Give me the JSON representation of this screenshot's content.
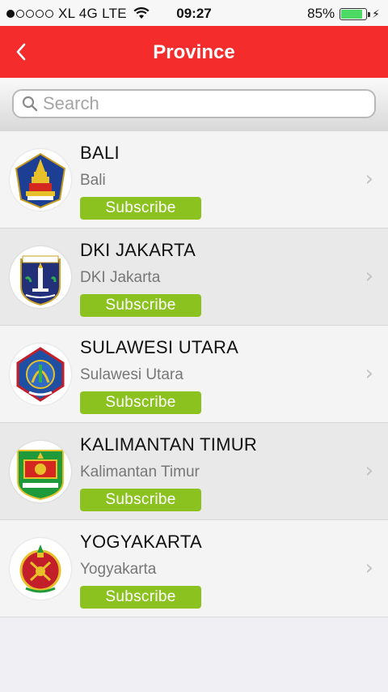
{
  "status_bar": {
    "carrier": "XL 4G LTE",
    "time": "09:27",
    "battery_percent": "85%",
    "battery_level": 0.85,
    "signal_bars_filled": 1,
    "signal_bars_total": 5
  },
  "nav": {
    "title": "Province",
    "back_icon": "chevron-left-icon"
  },
  "search": {
    "placeholder": "Search",
    "value": ""
  },
  "provinces": [
    {
      "name": "BALI",
      "subtitle": "Bali",
      "subscribe_label": "Subscribe"
    },
    {
      "name": "DKI JAKARTA",
      "subtitle": "DKI Jakarta",
      "subscribe_label": "Subscribe"
    },
    {
      "name": "SULAWESI UTARA",
      "subtitle": "Sulawesi Utara",
      "subscribe_label": "Subscribe"
    },
    {
      "name": "KALIMANTAN TIMUR",
      "subtitle": "Kalimantan Timur",
      "subscribe_label": "Subscribe"
    },
    {
      "name": "YOGYAKARTA",
      "subtitle": "Yogyakarta",
      "subscribe_label": "Subscribe"
    }
  ],
  "colors": {
    "nav_background": "#f52c2c",
    "subscribe_button": "#8cc21f",
    "battery": "#4cd964"
  }
}
